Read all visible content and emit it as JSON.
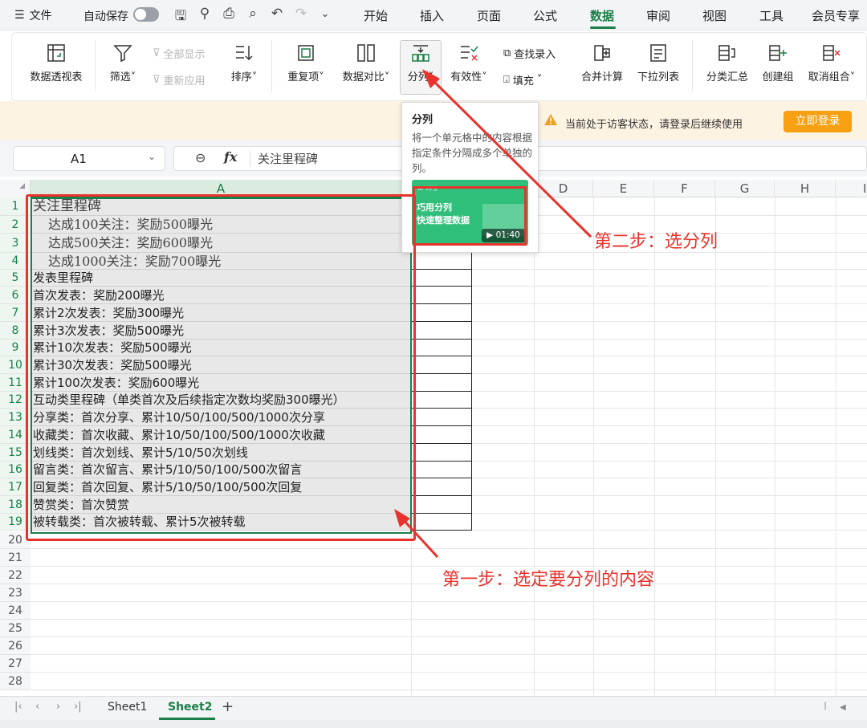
{
  "topbar": {
    "menu_label": "文件",
    "autosave_label": "自动保存",
    "tabs": [
      "开始",
      "插入",
      "页面",
      "公式",
      "数据",
      "审阅",
      "视图",
      "工具",
      "会员专享"
    ],
    "active_tab": "数据"
  },
  "ribbon": {
    "pivot": "数据透视表",
    "filter": "筛选",
    "show_all": "全部显示",
    "reapply": "重新应用",
    "sort": "排序",
    "duplicates": "重复项",
    "compare": "数据对比",
    "split": "分列",
    "validity": "有效性",
    "lookup": "查找录入",
    "fill": "填充",
    "consolidate": "合并计算",
    "dropdown": "下拉列表",
    "subtotal": "分类汇总",
    "group": "创建组",
    "ungroup": "取消组合"
  },
  "notice": {
    "text": "当前处于访客状态，请登录后继续使用",
    "login_button": "立即登录"
  },
  "formula_bar": {
    "cell_ref": "A1",
    "fx": "fx",
    "content": "关注里程碑"
  },
  "tooltip": {
    "title": "分列",
    "description": "将一个单元格中的内容根据指定条件分隔成多个单独的列。",
    "video_brand": "WPS学堂",
    "video_line1": "巧用分列",
    "video_line2": "快速整理数据",
    "video_duration": "01:40"
  },
  "columns": [
    "A",
    "",
    "D",
    "E",
    "F",
    "G",
    "H",
    "I"
  ],
  "rows": [
    {
      "num": "1",
      "text": "关注里程碑"
    },
    {
      "num": "2",
      "text": "达成100关注：奖励500曝光"
    },
    {
      "num": "3",
      "text": "达成500关注：奖励600曝光"
    },
    {
      "num": "4",
      "text": "达成1000关注：奖励700曝光"
    },
    {
      "num": "5",
      "text": "发表里程碑"
    },
    {
      "num": "6",
      "text": "首次发表：奖励200曝光"
    },
    {
      "num": "7",
      "text": "累计2次发表：奖励300曝光"
    },
    {
      "num": "8",
      "text": "累计3次发表：奖励500曝光"
    },
    {
      "num": "9",
      "text": "累计10次发表：奖励500曝光"
    },
    {
      "num": "10",
      "text": "累计30次发表：奖励500曝光"
    },
    {
      "num": "11",
      "text": "累计100次发表：奖励600曝光"
    },
    {
      "num": "12",
      "text": "互动类里程碑（单类首次及后续指定次数均奖励300曝光）"
    },
    {
      "num": "13",
      "text": "分享类：首次分享、累计10/50/100/500/1000次分享"
    },
    {
      "num": "14",
      "text": "收藏类：首次收藏、累计10/50/100/500/1000次收藏"
    },
    {
      "num": "15",
      "text": "划线类：首次划线、累计5/10/50次划线"
    },
    {
      "num": "16",
      "text": "留言类：首次留言、累计5/10/50/100/500次留言"
    },
    {
      "num": "17",
      "text": "回复类：首次回复、累计5/10/50/100/500次回复"
    },
    {
      "num": "18",
      "text": "赞赏类：首次赞赏"
    },
    {
      "num": "19",
      "text": "被转载类：首次被转载、累计5次被转载"
    }
  ],
  "empty_rows": [
    "20",
    "21",
    "22",
    "23",
    "24",
    "25",
    "26",
    "27",
    "28"
  ],
  "annotations": {
    "step1": "第一步：选定要分列的内容",
    "step2": "第二步：选分列"
  },
  "sheet_tabs": [
    "Sheet1",
    "Sheet2"
  ],
  "active_sheet": "Sheet2",
  "colors": {
    "accent": "#1b7f4a",
    "annotation": "#e8322c",
    "login": "#f7a012"
  }
}
